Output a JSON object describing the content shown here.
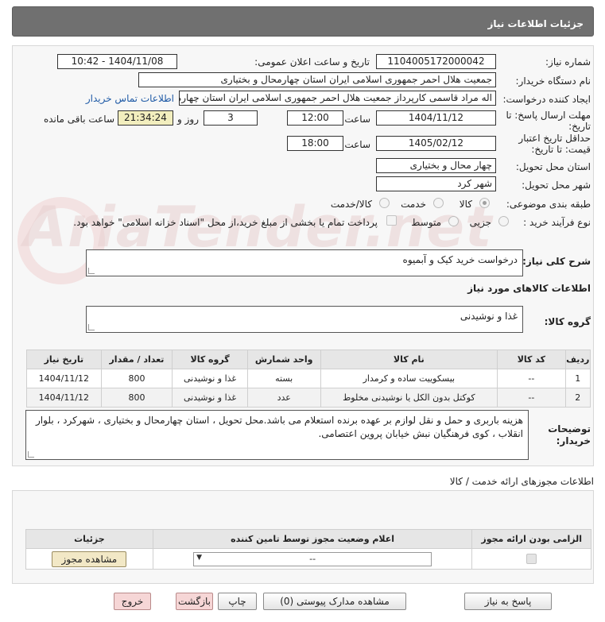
{
  "header": {
    "title": "جزئیات اطلاعات نیاز"
  },
  "form": {
    "need_number_label": "شماره نیاز:",
    "need_number": "1104005172000042",
    "announce_label": "تاریخ و ساعت اعلان عمومی:",
    "announce_value": "1404/11/08 - 10:42",
    "buyer_org_label": "نام دستگاه خریدار:",
    "buyer_org": "جمعیت هلال احمر جمهوری اسلامی ایران استان چهارمحال و بختیاری",
    "creator_label": "ایجاد کننده درخواست:",
    "creator": "اله مراد قاسمی کارپرداز جمعیت هلال احمر جمهوری اسلامی ایران استان چهارمحال و بختیاری",
    "contact_link": "اطلاعات تماس خریدار",
    "send_deadline_label_1": "مهلت ارسال پاسخ: تا",
    "send_deadline_label_2": "تاریخ:",
    "send_date": "1404/11/12",
    "time_label": "ساعت",
    "send_time": "12:00",
    "days_value": "3",
    "days_label": "روز و",
    "remaining_value": "21:34:24",
    "remaining_label": "ساعت باقی مانده",
    "validity_label_1": "حداقل تاریخ اعتبار",
    "validity_label_2": "قیمت: تا تاریخ:",
    "validity_date": "1405/02/12",
    "validity_time_label": "ساعت",
    "validity_time": "18:00",
    "province_label": "استان محل تحویل:",
    "province": "چهار محال و بختیاری",
    "city_label": "شهر محل تحویل:",
    "city": "شهر کرد",
    "category_label": "طبقه بندی موضوعی:",
    "category_options": [
      "کالا",
      "خدمت",
      "کالا/خدمت"
    ],
    "process_label": "نوع فرآیند خرید :",
    "process_options": [
      "جزیی",
      "متوسط"
    ],
    "payment_note": "پرداخت تمام یا بخشی از مبلغ خرید،از محل \"اسناد خزانه اسلامی\" خواهد بود."
  },
  "description": {
    "label": "شرح کلی نیاز:",
    "value": "درخواست خرید کیک و آبمیوه"
  },
  "goods_info_title": "اطلاعات کالاهای مورد نیاز",
  "goods_group": {
    "label": "گروه کالا:",
    "value": "غذا و نوشیدنی"
  },
  "items_table": {
    "headers": [
      "ردیف",
      "کد کالا",
      "نام کالا",
      "واحد شمارش",
      "گروه کالا",
      "تعداد / مقدار",
      "تاریخ نیاز"
    ],
    "rows": [
      [
        "1",
        "--",
        "بیسکوییت ساده و کرمدار",
        "بسته",
        "غذا و نوشیدنی",
        "800",
        "1404/11/12"
      ],
      [
        "2",
        "--",
        "کوکتل بدون الکل یا نوشیدنی مخلوط",
        "عدد",
        "غذا و نوشیدنی",
        "800",
        "1404/11/12"
      ]
    ]
  },
  "buyer_notes": {
    "label_1": "توضیحات",
    "label_2": "خریدار:",
    "value": "هزینه باربری و حمل و نقل لوازم بر عهده برنده استعلام می باشد.محل تحویل ، استان چهارمحال و بختیاری ، شهرکرد ، بلوار انقلاب ، کوی فرهنگیان نبش خیابان پروین اعتصامی."
  },
  "license": {
    "title": "اطلاعات مجوزهای ارائه خدمت / کالا",
    "headers": [
      "الزامی بودن ارائه مجوز",
      "اعلام وضعیت مجوز توسط تامین کننده",
      "جزئیات"
    ],
    "select_value": "--",
    "view_button": "مشاهده مجوز"
  },
  "watermark": "AriaTender.net",
  "buttons": {
    "reply": "پاسخ به نیاز",
    "attachments": "مشاهده مدارک پیوستی (0)",
    "print": "چاپ",
    "back": "بازگشت",
    "exit": "خروج"
  },
  "colors": {
    "header_bg": "#707070",
    "link": "#1f5aa6",
    "remaining_bg": "#f2eebe",
    "exit_bg": "#f6d6d6",
    "back_bg": "#f6d6d6"
  }
}
